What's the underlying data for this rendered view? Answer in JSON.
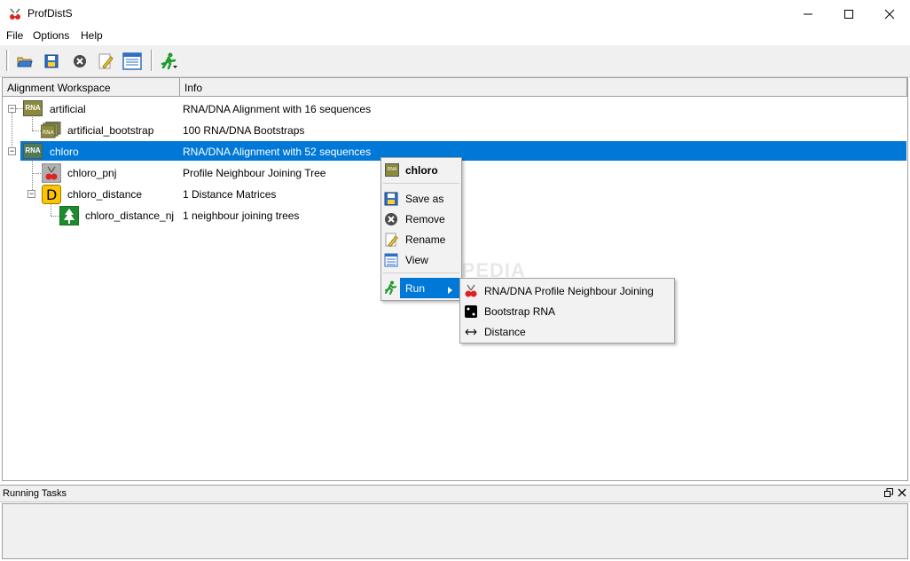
{
  "window": {
    "title": "ProfDistS",
    "controls": {
      "minimize": "minimize",
      "maximize": "maximize",
      "close": "close"
    }
  },
  "menubar": {
    "items": [
      "File",
      "Options",
      "Help"
    ]
  },
  "toolbar": {
    "buttons": [
      "open-icon",
      "save-icon",
      "remove-icon",
      "rename-icon",
      "view-icon",
      "run-icon"
    ]
  },
  "tree": {
    "columns": [
      "Alignment Workspace",
      "Info"
    ],
    "rows": [
      {
        "name": "artificial",
        "info": "RNA/DNA Alignment with 16 sequences",
        "icon": "rna-icon",
        "level": 0
      },
      {
        "name": "artificial_bootstrap",
        "info": "100 RNA/DNA Bootstraps",
        "icon": "rna-stack-icon",
        "level": 1
      },
      {
        "name": "chloro",
        "info": "RNA/DNA Alignment with 52 sequences",
        "icon": "rna-icon",
        "level": 0,
        "selected": true
      },
      {
        "name": "chloro_pnj",
        "info": "Profile Neighbour Joining Tree",
        "icon": "pnj-icon",
        "level": 1
      },
      {
        "name": "chloro_distance",
        "info": "1 Distance Matrices",
        "icon": "distance-matrix-icon",
        "level": 1
      },
      {
        "name": "chloro_distance_nj",
        "info": "1 neighbour joining trees",
        "icon": "tree-icon",
        "level": 2
      }
    ]
  },
  "context_menu": {
    "header": "chloro",
    "items": [
      "Save as",
      "Remove",
      "Rename",
      "View"
    ],
    "run": "Run",
    "rna_icon_text": "RNA"
  },
  "submenu": {
    "items": [
      "RNA/DNA Profile Neighbour Joining",
      "Bootstrap RNA",
      "Distance"
    ]
  },
  "running_tasks": {
    "title": "Running Tasks"
  },
  "watermark": "SOFTPEDIA",
  "colors": {
    "selection": "#0078d7",
    "panel": "#f0f0f0"
  }
}
